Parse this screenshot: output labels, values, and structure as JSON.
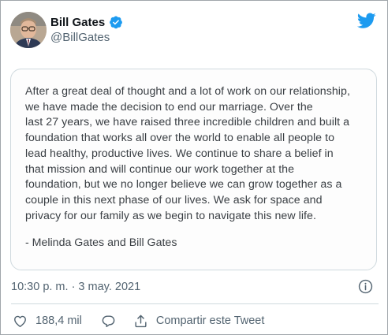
{
  "author": {
    "name": "Bill Gates",
    "handle": "@BillGates",
    "verified": true
  },
  "brand": {
    "icon": "twitter-bird-icon",
    "color": "#1d9bf0"
  },
  "statement": {
    "lines": [
      "After a great deal of thought and a lot of work on our relationship,",
      "we have made the decision to end our marriage. Over the",
      "last 27 years, we have raised three incredible children and built a",
      "foundation that works all over the world to enable all people to",
      "lead healthy, productive lives. We continue to share a belief in",
      "that mission and will continue our work together at the",
      "foundation, but we no longer believe we can grow together as a",
      "couple in this next phase of our lives. We ask for space and",
      "privacy for our family as we begin to navigate this new life."
    ],
    "signature": "- Melinda Gates and Bill Gates"
  },
  "meta": {
    "timestamp": "10:30 p. m. · 3 may. 2021",
    "info_icon": "info-icon"
  },
  "actions": {
    "like_count": "188,4 mil",
    "reply_icon": "comment-icon",
    "share_label": "Compartir este Tweet"
  }
}
